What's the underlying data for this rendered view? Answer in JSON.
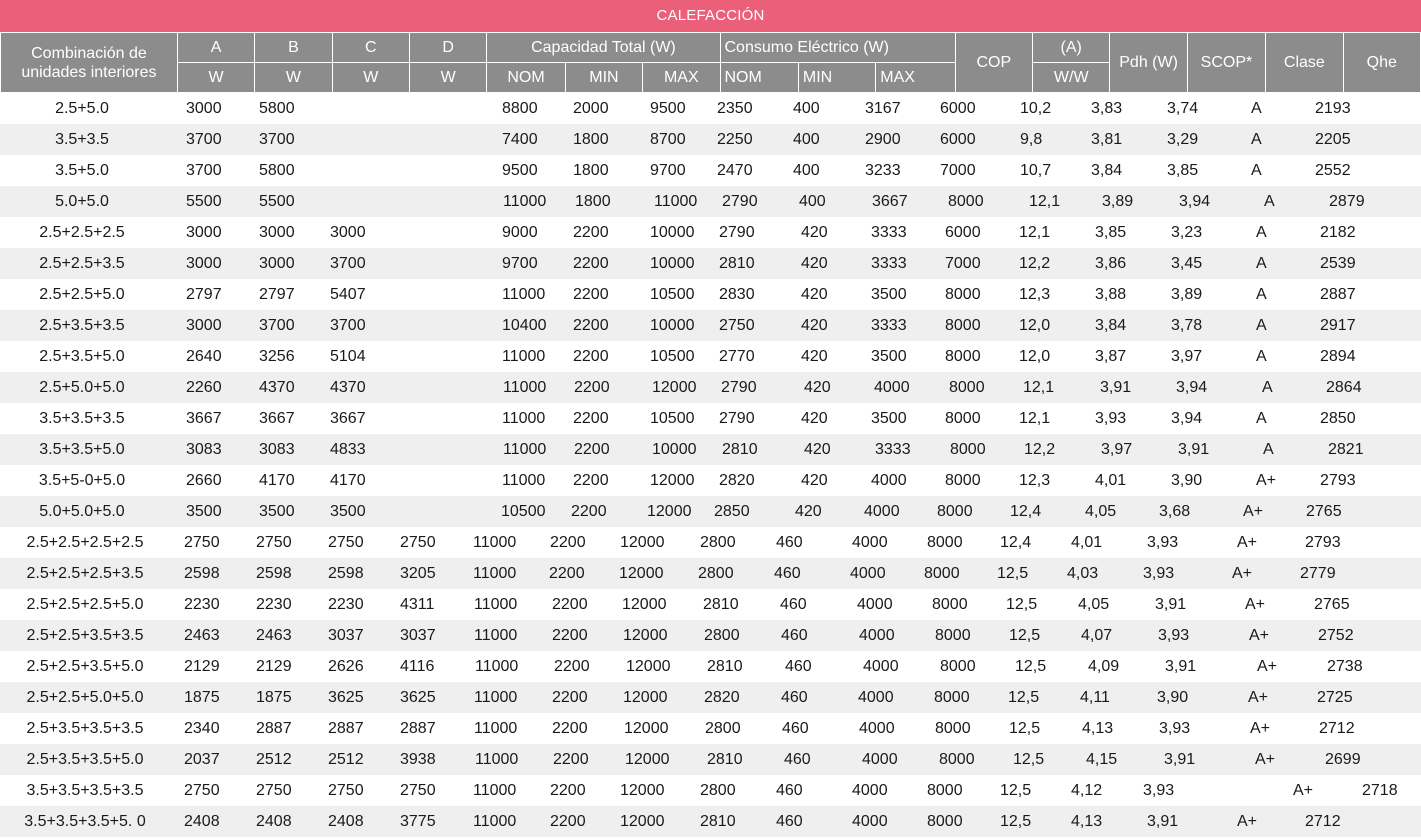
{
  "title": "CALEFACCIÓN",
  "header": {
    "combo": "Combinación de unidades interiores",
    "units": [
      "A",
      "B",
      "C",
      "D"
    ],
    "unit_w": "W",
    "capacity": "Capacidad Total (W)",
    "consumption": "Consumo Eléctrico (W)",
    "nom": "NOM",
    "min": "MIN",
    "max": "MAX",
    "cop": "COP",
    "amp": "(A)",
    "ww": "W/W",
    "pdh": "Pdh (W)",
    "scop": "SCOP*",
    "clase": "Clase",
    "qhe": "Qhe"
  },
  "rows": [
    {
      "combo": "2.5+5.0",
      "cells": [
        "3000",
        "5800",
        "8800",
        "2000",
        "9500",
        "2350",
        "400",
        "3167",
        "6000",
        "10,2",
        "3,83",
        "3,74",
        "A",
        "2193"
      ]
    },
    {
      "combo": "3.5+3.5",
      "cells": [
        "3700",
        "3700",
        "7400",
        "1800",
        "8700",
        "2250",
        "400",
        "2900",
        "6000",
        "9,8",
        "3,81",
        "3,29",
        "A",
        "2205"
      ]
    },
    {
      "combo": "3.5+5.0",
      "cells": [
        "3700",
        "5800",
        "9500",
        "1800",
        "9700",
        "2470",
        "400",
        "3233",
        "7000",
        "10,7",
        "3,84",
        "3,85",
        "A",
        "2552"
      ]
    },
    {
      "combo": "5.0+5.0",
      "cells": [
        "5500",
        "5500",
        "11000",
        "1800",
        "11000",
        "2790",
        "400",
        "3667",
        "8000",
        "12,1",
        "3,89",
        "3,94",
        "A",
        "2879"
      ]
    },
    {
      "combo": "2.5+2.5+2.5",
      "cells": [
        "3000",
        "3000",
        "3000",
        "9000",
        "2200",
        "10000",
        "2790",
        "420",
        "3333",
        "6000",
        "12,1",
        "3,85",
        "3,23",
        "A",
        "2182"
      ]
    },
    {
      "combo": "2.5+2.5+3.5",
      "cells": [
        "3000",
        "3000",
        "3700",
        "9700",
        "2200",
        "10000",
        "2810",
        "420",
        "3333",
        "7000",
        "12,2",
        "3,86",
        "3,45",
        "A",
        "2539"
      ]
    },
    {
      "combo": "2.5+2.5+5.0",
      "cells": [
        "2797",
        "2797",
        "5407",
        "11000",
        "2200",
        "10500",
        "2830",
        "420",
        "3500",
        "8000",
        "12,3",
        "3,88",
        "3,89",
        "A",
        "2887"
      ]
    },
    {
      "combo": "2.5+3.5+3.5",
      "cells": [
        "3000",
        "3700",
        "3700",
        "10400",
        "2200",
        "10000",
        "2750",
        "420",
        "3333",
        "8000",
        "12,0",
        "3,84",
        "3,78",
        "A",
        "2917"
      ]
    },
    {
      "combo": "2.5+3.5+5.0",
      "cells": [
        "2640",
        "3256",
        "5104",
        "11000",
        "2200",
        "10500",
        "2770",
        "420",
        "3500",
        "8000",
        "12,0",
        "3,87",
        "3,97",
        "A",
        "2894"
      ]
    },
    {
      "combo": "2.5+5.0+5.0",
      "cells": [
        "2260",
        "4370",
        "4370",
        "11000",
        "2200",
        "12000",
        "2790",
        "420",
        "4000",
        "8000",
        "12,1",
        "3,91",
        "3,94",
        "A",
        "2864"
      ]
    },
    {
      "combo": "3.5+3.5+3.5",
      "cells": [
        "3667",
        "3667",
        "3667",
        "11000",
        "2200",
        "10500",
        "2790",
        "420",
        "3500",
        "8000",
        "12,1",
        "3,93",
        "3,94",
        "A",
        "2850"
      ]
    },
    {
      "combo": "3.5+3.5+5.0",
      "cells": [
        "3083",
        "3083",
        "4833",
        "11000",
        "2200",
        "10000",
        "2810",
        "420",
        "3333",
        "8000",
        "12,2",
        "3,97",
        "3,91",
        "A",
        "2821"
      ]
    },
    {
      "combo": "3.5+5-0+5.0",
      "cells": [
        "2660",
        "4170",
        "4170",
        "11000",
        "2200",
        "12000",
        "2820",
        "420",
        "4000",
        "8000",
        "12,3",
        "4,01",
        "3,90",
        "A+",
        "2793"
      ]
    },
    {
      "combo": "5.0+5.0+5.0",
      "cells": [
        "3500",
        "3500",
        "3500",
        "10500",
        "2200",
        "12000",
        "2850",
        "420",
        "4000",
        "8000",
        "12,4",
        "4,05",
        "3,68",
        "A+",
        "2765"
      ]
    },
    {
      "combo": "2.5+2.5+2.5+2.5",
      "cells": [
        "2750",
        "2750",
        "2750",
        "2750",
        "11000",
        "2200",
        "12000",
        "2800",
        "460",
        "4000",
        "8000",
        "12,4",
        "4,01",
        "3,93",
        "A+",
        "2793"
      ]
    },
    {
      "combo": "2.5+2.5+2.5+3.5",
      "cells": [
        "2598",
        "2598",
        "2598",
        "3205",
        "11000",
        "2200",
        "12000",
        "2800",
        "460",
        "4000",
        "8000",
        "12,5",
        "4,03",
        "3,93",
        "A+",
        "2779"
      ]
    },
    {
      "combo": "2.5+2.5+2.5+5.0",
      "cells": [
        "2230",
        "2230",
        "2230",
        "4311",
        "11000",
        "2200",
        "12000",
        "2810",
        "460",
        "4000",
        "8000",
        "12,5",
        "4,05",
        "3,91",
        "A+",
        "2765"
      ]
    },
    {
      "combo": "2.5+2.5+3.5+3.5",
      "cells": [
        "2463",
        "2463",
        "3037",
        "3037",
        "11000",
        "2200",
        "12000",
        "2800",
        "460",
        "4000",
        "8000",
        "12,5",
        "4,07",
        "3,93",
        "A+",
        "2752"
      ]
    },
    {
      "combo": "2.5+2.5+3.5+5.0",
      "cells": [
        "2129",
        "2129",
        "2626",
        "4116",
        "11000",
        "2200",
        "12000",
        "2810",
        "460",
        "4000",
        "8000",
        "12,5",
        "4,09",
        "3,91",
        "A+",
        "2738"
      ]
    },
    {
      "combo": "2.5+2.5+5.0+5.0",
      "cells": [
        "1875",
        "1875",
        "3625",
        "3625",
        "11000",
        "2200",
        "12000",
        "2820",
        "460",
        "4000",
        "8000",
        "12,5",
        "4,11",
        "3,90",
        "A+",
        "2725"
      ]
    },
    {
      "combo": "2.5+3.5+3.5+3.5",
      "cells": [
        "2340",
        "2887",
        "2887",
        "2887",
        "11000",
        "2200",
        "12000",
        "2800",
        "460",
        "4000",
        "8000",
        "12,5",
        "4,13",
        "3,93",
        "A+",
        "2712"
      ]
    },
    {
      "combo": "2.5+3.5+3.5+5.0",
      "cells": [
        "2037",
        "2512",
        "2512",
        "3938",
        "11000",
        "2200",
        "12000",
        "2810",
        "460",
        "4000",
        "8000",
        "12,5",
        "4,15",
        "3,91",
        "A+",
        "2699"
      ]
    },
    {
      "combo": "3.5+3.5+3.5+3.5",
      "cells": [
        "2750",
        "2750",
        "2750",
        "2750",
        "11000",
        "2200",
        "12000",
        "2800",
        "460",
        "4000",
        "8000",
        "12,5",
        "4,12",
        "3,93",
        "A+",
        "2718"
      ]
    },
    {
      "combo": "3.5+3.5+3.5+5. 0",
      "cells": [
        "2408",
        "2408",
        "2408",
        "3775",
        "11000",
        "2200",
        "12000",
        "2810",
        "460",
        "4000",
        "8000",
        "12,5",
        "4,13",
        "3,91",
        "A+",
        "2712"
      ]
    }
  ]
}
